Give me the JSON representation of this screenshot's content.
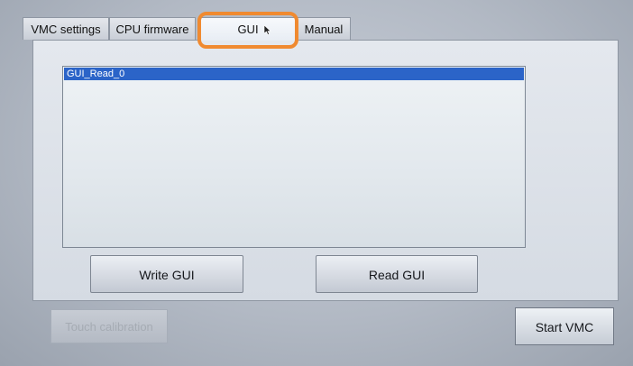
{
  "tabs": [
    {
      "label": "VMC settings"
    },
    {
      "label": "CPU firmware"
    },
    {
      "label": "GUI"
    },
    {
      "label": "Manual"
    }
  ],
  "list": {
    "items": [
      {
        "label": "GUI_Read_0",
        "selected": true
      }
    ]
  },
  "buttons": {
    "write": "Write GUI",
    "read": "Read GUI",
    "touch_calibration": "Touch calibration",
    "start_vmc": "Start VMC"
  },
  "colors": {
    "highlight": "#f08a30",
    "selection": "#2b64c8"
  },
  "icons": {
    "cursor": "cursor-icon"
  }
}
